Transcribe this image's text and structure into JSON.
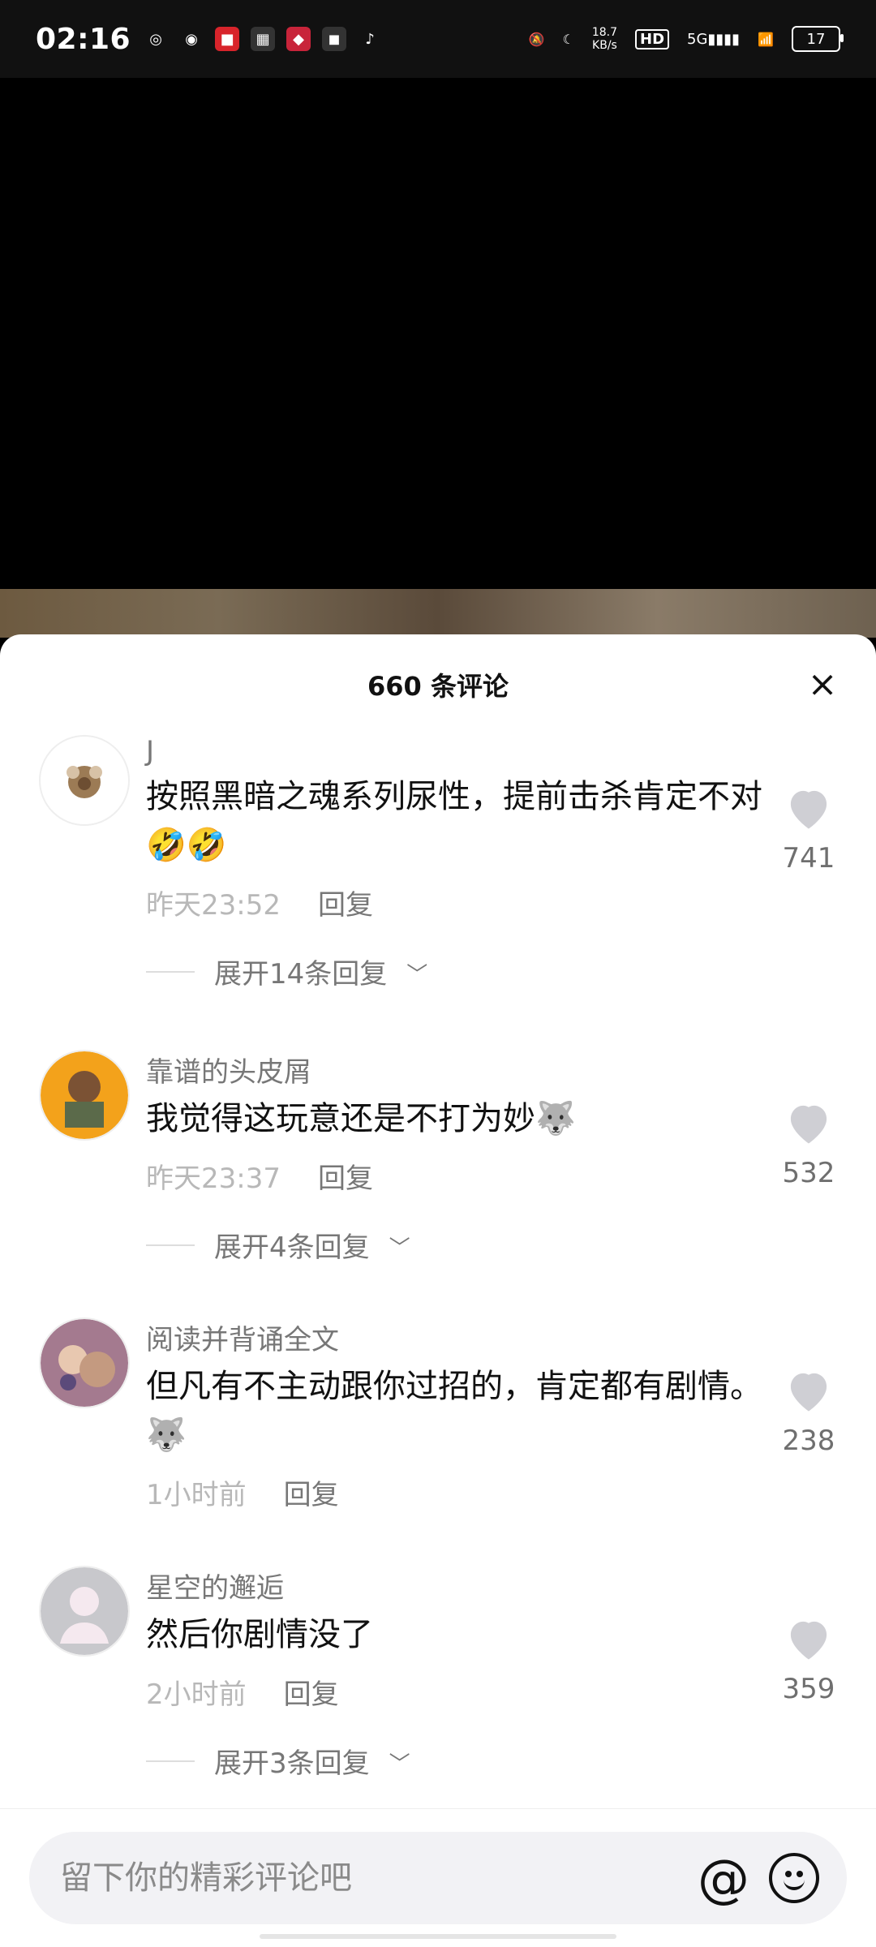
{
  "status": {
    "time": "02:16",
    "net_speed_top": "18.7",
    "net_speed_bottom": "KB/s",
    "hd": "HD",
    "signal": "5G",
    "battery": "17"
  },
  "comments_sheet": {
    "title": "660 条评论",
    "close_label": "×",
    "comments": [
      {
        "username": "J",
        "text": "按照黑暗之魂系列尿性，提前击杀肯定不对🤣🤣",
        "time": "昨天23:52",
        "reply_label": "回复",
        "expand_label": "展开14条回复",
        "likes": "741"
      },
      {
        "username": "靠谱的头皮屑",
        "text": "我觉得这玩意还是不打为妙🐺",
        "time": "昨天23:37",
        "reply_label": "回复",
        "expand_label": "展开4条回复",
        "likes": "532"
      },
      {
        "username": "阅读并背诵全文",
        "text": "但凡有不主动跟你过招的，肯定都有剧情。🐺",
        "time": "1小时前",
        "reply_label": "回复",
        "likes": "238"
      },
      {
        "username": "星空的邂逅",
        "text": "然后你剧情没了",
        "time": "2小时前",
        "reply_label": "回复",
        "expand_label": "展开3条回复",
        "likes": "359"
      }
    ]
  },
  "input": {
    "placeholder": "留下你的精彩评论吧",
    "at_label": "@"
  }
}
